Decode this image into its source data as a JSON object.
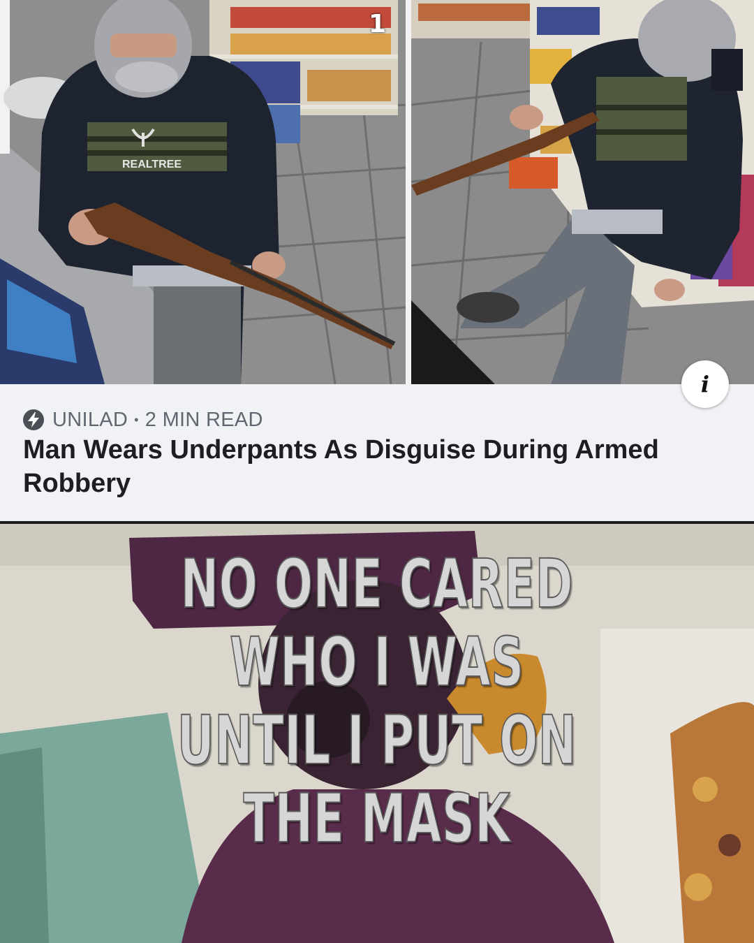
{
  "surveillance": {
    "frame_number": "1",
    "shirt_brand_text": "REALTREE"
  },
  "info_button": {
    "icon": "info-icon",
    "glyph": "i"
  },
  "article": {
    "source": "UNILAD",
    "separator": "•",
    "read_time": "2 MIN READ",
    "source_icon": "lightning-bolt-icon",
    "headline": "Man Wears Underpants As Disguise During Armed Robbery"
  },
  "meme": {
    "caption_lines": [
      "NO ONE CARED",
      "WHO I WAS",
      "UNTIL I PUT ON",
      "THE MASK"
    ]
  },
  "colors": {
    "card_background": "#f0f2f5",
    "headline_text": "#1c1e21",
    "meta_text": "#606770",
    "meme_purple": "#5a2c4c"
  }
}
